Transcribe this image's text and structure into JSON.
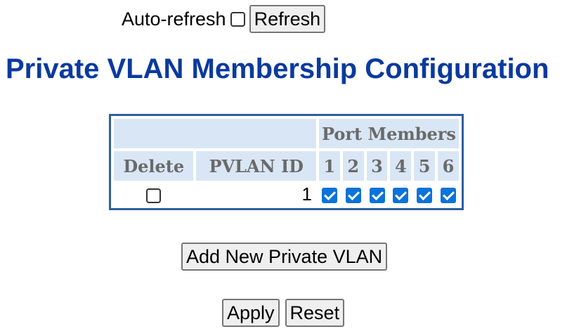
{
  "refresh": {
    "label": "Auto-refresh",
    "auto_refresh_checked": false,
    "button_label": "Refresh"
  },
  "page": {
    "title": "Private VLAN Membership Configuration"
  },
  "table": {
    "port_members_header": "Port Members",
    "columns": {
      "delete": "Delete",
      "pvlan_id": "PVLAN ID"
    },
    "ports": [
      "1",
      "2",
      "3",
      "4",
      "5",
      "6"
    ],
    "rows": [
      {
        "delete_checked": false,
        "pvlan_id": "1",
        "members": [
          true,
          true,
          true,
          true,
          true,
          true
        ]
      }
    ]
  },
  "buttons": {
    "add_new": "Add New Private VLAN",
    "apply": "Apply",
    "reset": "Reset"
  },
  "colors": {
    "title": "#0a3a9e",
    "header_bg": "#d9e6f5",
    "table_border": "#2f5e9e",
    "checkbox_checked": "#0b73d9"
  }
}
